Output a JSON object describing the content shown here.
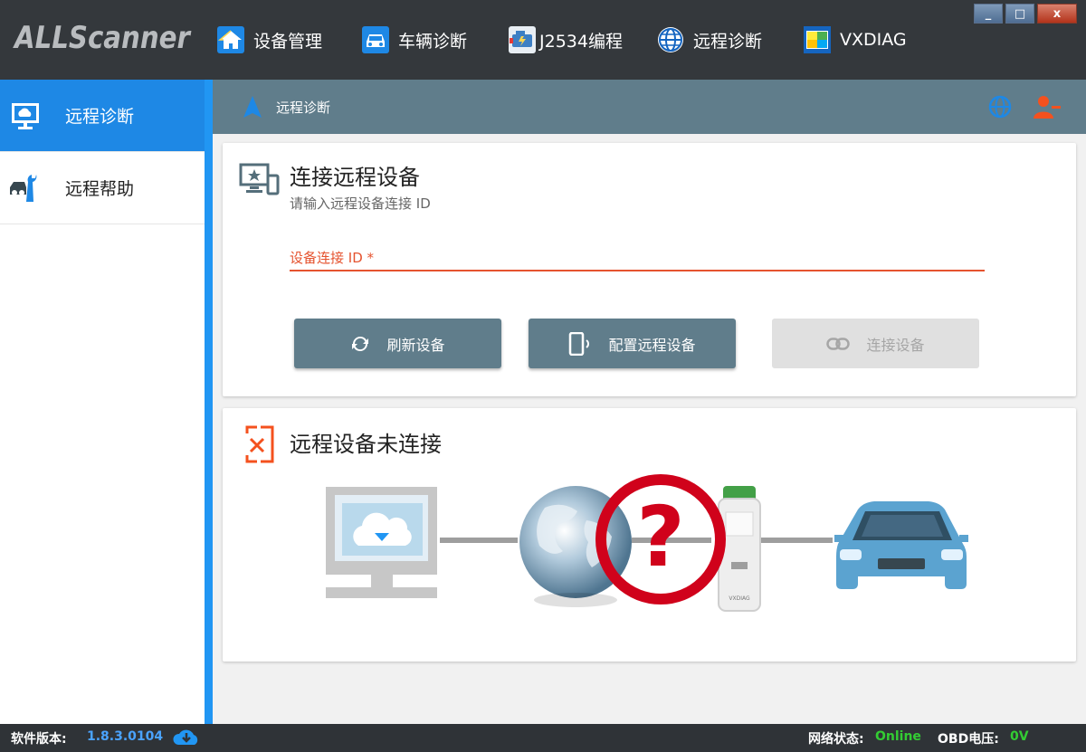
{
  "app": {
    "logo_text": "ALLScanner"
  },
  "top_nav": {
    "items": [
      {
        "label": "设备管理",
        "icon": "home-icon"
      },
      {
        "label": "车辆诊断",
        "icon": "car-icon"
      },
      {
        "label": "J2534编程",
        "icon": "engine-icon"
      },
      {
        "label": "远程诊断",
        "icon": "globe-icon"
      },
      {
        "label": "VXDIAG",
        "icon": "vxdiag-icon"
      }
    ]
  },
  "window_controls": {
    "minimize": "_",
    "maximize": "□",
    "close": "x"
  },
  "sidebar": {
    "items": [
      {
        "label": "远程诊断",
        "icon": "monitor-cloud-icon",
        "active": true
      },
      {
        "label": "远程帮助",
        "icon": "wrench-car-icon",
        "active": false
      }
    ]
  },
  "subheader": {
    "title": "远程诊断",
    "icons": [
      "navigation-arrow-icon",
      "globe-icon",
      "user-remove-icon"
    ]
  },
  "connect_card": {
    "title": "连接远程设备",
    "subtitle": "请输入远程设备连接 ID",
    "field_label": "设备连接 ID *",
    "field_value": "",
    "buttons": {
      "refresh": "刷新设备",
      "configure": "配置远程设备",
      "connect": "连接设备"
    }
  },
  "status_card": {
    "title": "远程设备未连接",
    "diagram_nodes": [
      "computer-cloud-icon",
      "globe-icon",
      "vxdiag-device-icon",
      "car-icon"
    ],
    "error_mark": "?"
  },
  "statusbar": {
    "version_label": "软件版本:",
    "version_value": "1.8.3.0104",
    "network_label": "网络状态:",
    "network_value": "Online",
    "obd_label": "OBD电压:",
    "obd_value": "0V"
  },
  "colors": {
    "accent_blue": "#2196f3",
    "header_gray": "#607d8b",
    "error_orange": "#e5532f",
    "online_green": "#33cc33",
    "version_blue": "#4aa3ff"
  }
}
